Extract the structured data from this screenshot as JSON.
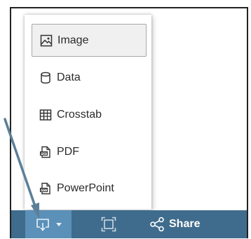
{
  "download_menu": {
    "items": [
      {
        "label": "Image",
        "icon": "image-icon"
      },
      {
        "label": "Data",
        "icon": "database-icon"
      },
      {
        "label": "Crosstab",
        "icon": "crosstab-icon"
      },
      {
        "label": "PDF",
        "icon": "pdf-icon"
      },
      {
        "label": "PowerPoint",
        "icon": "powerpoint-icon"
      }
    ],
    "selected_index": 0
  },
  "toolbar": {
    "download_icon": "download-icon",
    "fullscreen_icon": "fullscreen-icon",
    "share_icon": "share-icon",
    "share_label": "Share"
  },
  "colors": {
    "toolbar_bg": "#3f6c8c",
    "download_button_bg": "#5b90b8",
    "annotation_arrow": "#5b7f99",
    "menu_selected_bg": "#f0f0f0"
  }
}
